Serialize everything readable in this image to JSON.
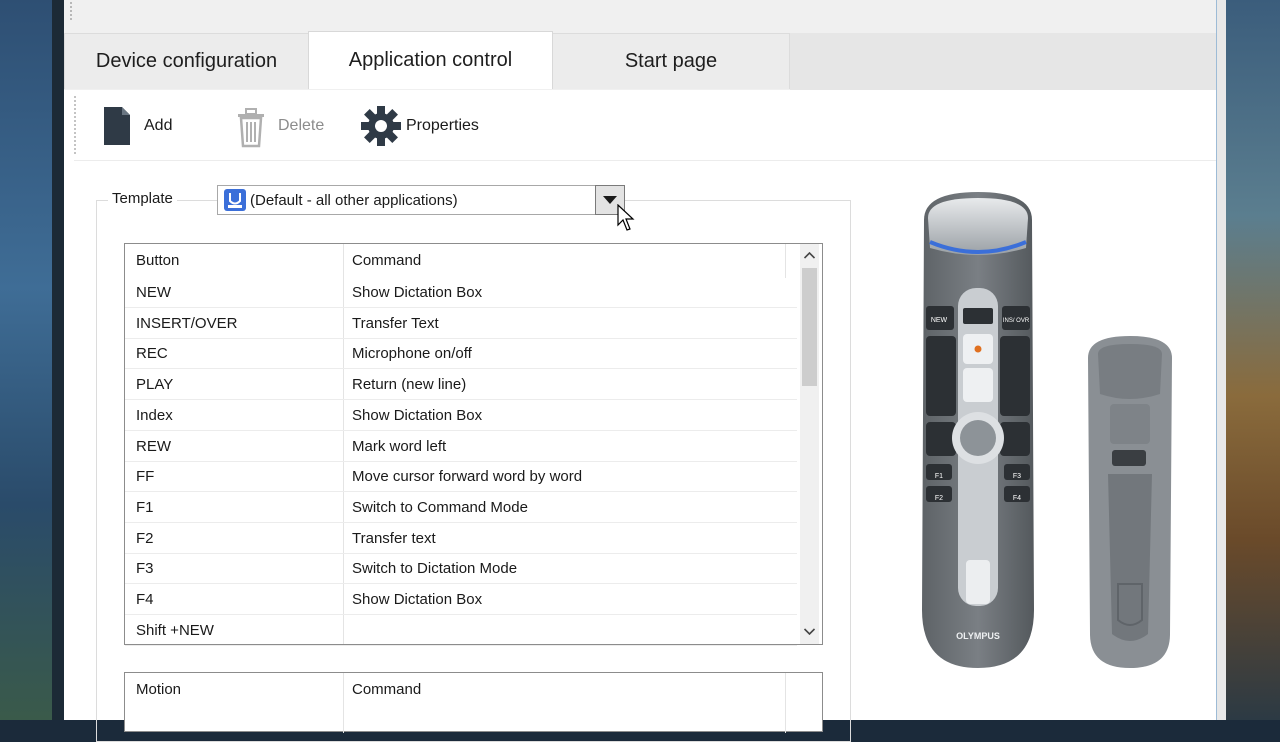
{
  "tabs": [
    {
      "label": "Device configuration"
    },
    {
      "label": "Application control"
    },
    {
      "label": "Start page"
    }
  ],
  "toolbar": {
    "add_label": "Add",
    "delete_label": "Delete",
    "properties_label": "Properties"
  },
  "template": {
    "label": "Template",
    "selected": "(Default - all other applications)"
  },
  "buttons_table": {
    "headers": [
      "Button",
      "Command"
    ],
    "rows": [
      [
        "NEW",
        "Show Dictation Box"
      ],
      [
        "INSERT/OVER",
        "Transfer Text"
      ],
      [
        "REC",
        "Microphone on/off"
      ],
      [
        "PLAY",
        "Return (new line)"
      ],
      [
        "Index",
        "Show Dictation Box"
      ],
      [
        "REW",
        "Mark word left"
      ],
      [
        "FF",
        "Move cursor forward word by word"
      ],
      [
        "F1",
        "Switch to Command Mode"
      ],
      [
        "F2",
        "Transfer text"
      ],
      [
        "F3",
        "Switch to Dictation Mode"
      ],
      [
        "F4",
        "Show Dictation Box"
      ],
      [
        "Shift +NEW",
        ""
      ]
    ]
  },
  "motion_table": {
    "headers": [
      "Motion",
      "Command"
    ]
  },
  "device": {
    "brand": "OLYMPUS",
    "keys": {
      "new": "NEW",
      "ins": "INS/\nOVR",
      "f1": "F1",
      "f2": "F2",
      "f3": "F3",
      "f4": "F4"
    }
  },
  "colors": {
    "accent_blue": "#3b6fd9",
    "record_dot": "#e07020",
    "device_body": "#6f7478"
  }
}
